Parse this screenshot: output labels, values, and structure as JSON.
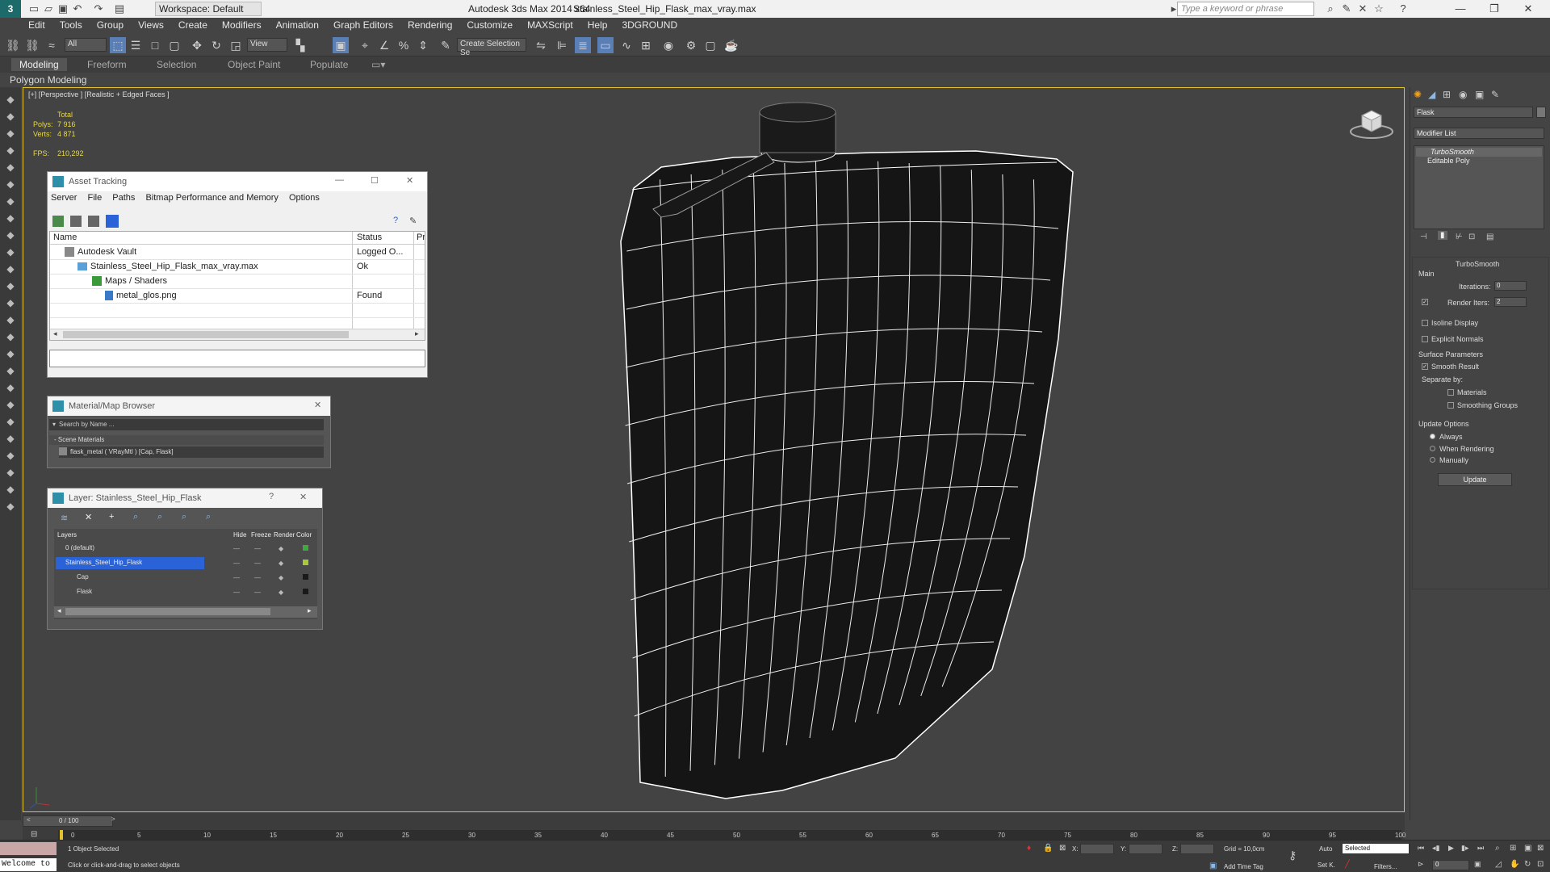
{
  "titlebar": {
    "app_title": "Autodesk 3ds Max  2014 x64",
    "file_title": "Stainless_Steel_Hip_Flask_max_vray.max",
    "workspace": "Workspace: Default",
    "search_placeholder": "Type a keyword or phrase"
  },
  "menu": [
    "Edit",
    "Tools",
    "Group",
    "Views",
    "Create",
    "Modifiers",
    "Animation",
    "Graph Editors",
    "Rendering",
    "Customize",
    "MAXScript",
    "Help",
    "3DGROUND"
  ],
  "toolbar": {
    "filter": "All",
    "view": "View",
    "selection_set": "Create Selection Se"
  },
  "ribbon": {
    "tabs": [
      "Modeling",
      "Freeform",
      "Selection",
      "Object Paint",
      "Populate"
    ],
    "active_tab": "Modeling",
    "sub_label": "Polygon Modeling"
  },
  "viewport": {
    "label": "[+] [Perspective ] [Realistic + Edged Faces ]",
    "total_label": "Total",
    "polys_label": "Polys:",
    "polys_value": "7 916",
    "verts_label": "Verts:",
    "verts_value": "4 871",
    "fps_label": "FPS:",
    "fps_value": "210,292"
  },
  "asset_tracking": {
    "title": "Asset Tracking",
    "menu": [
      "Server",
      "File",
      "Paths",
      "Bitmap Performance and Memory",
      "Options"
    ],
    "columns": [
      "Name",
      "Status",
      "Pr"
    ],
    "rows": [
      {
        "name": "Autodesk Vault",
        "status": "Logged O..."
      },
      {
        "name": "Stainless_Steel_Hip_Flask_max_vray.max",
        "status": "Ok"
      },
      {
        "name": "Maps / Shaders",
        "status": ""
      },
      {
        "name": "metal_glos.png",
        "status": "Found"
      }
    ]
  },
  "material_browser": {
    "title": "Material/Map Browser",
    "search_placeholder": "Search by Name ...",
    "group": "- Scene Materials",
    "item": "flask_metal  ( VRayMtl ) [Cap, Flask]"
  },
  "layer_panel": {
    "title": "Layer: Stainless_Steel_Hip_Flask",
    "help": "?",
    "columns": [
      "Layers",
      "Hide",
      "Freeze",
      "Render",
      "Color"
    ],
    "rows": [
      {
        "name": "0 (default)",
        "selected": false,
        "color": "#3fa83f"
      },
      {
        "name": "Stainless_Steel_Hip_Flask",
        "selected": true,
        "color": "#a8c83a"
      },
      {
        "name": "Cap",
        "selected": false,
        "color": "#1a1a1a"
      },
      {
        "name": "Flask",
        "selected": false,
        "color": "#1a1a1a"
      }
    ]
  },
  "command_panel": {
    "object_name": "Flask",
    "modifier_list": "Modifier List",
    "stack": [
      "TurboSmooth",
      "Editable Poly"
    ],
    "rollout_title": "TurboSmooth",
    "main_label": "Main",
    "iterations_label": "Iterations:",
    "iterations_value": "0",
    "render_iters_label": "Render Iters:",
    "render_iters_value": "2",
    "isoline": "Isoline Display",
    "explicit_normals": "Explicit Normals",
    "surface_params": "Surface Parameters",
    "smooth_result": "Smooth Result",
    "separate_by": "Separate by:",
    "materials": "Materials",
    "smoothing_groups": "Smoothing Groups",
    "update_options": "Update Options",
    "always": "Always",
    "when_rendering": "When Rendering",
    "manually": "Manually",
    "update_button": "Update"
  },
  "timeline": {
    "frame": "0 / 100",
    "ticks": [
      "0",
      "5",
      "10",
      "15",
      "20",
      "25",
      "30",
      "35",
      "40",
      "45",
      "50",
      "55",
      "60",
      "65",
      "70",
      "75",
      "80",
      "85",
      "90",
      "95",
      "100"
    ]
  },
  "statusbar": {
    "maxscript": "Welcome to",
    "selected": "1 Object Selected",
    "prompt": "Click or click-and-drag to select objects",
    "x_label": "X:",
    "y_label": "Y:",
    "z_label": "Z:",
    "grid": "Grid = 10,0cm",
    "add_time_tag": "Add Time Tag",
    "auto": "Auto",
    "set_key": "Set K.",
    "selected_dd": "Selected",
    "filters": "Filters...",
    "frame_field": "0"
  },
  "colors": {
    "accent": "#e4c22a",
    "selection": "#2a62d8",
    "viewport_bg": "#434343"
  }
}
